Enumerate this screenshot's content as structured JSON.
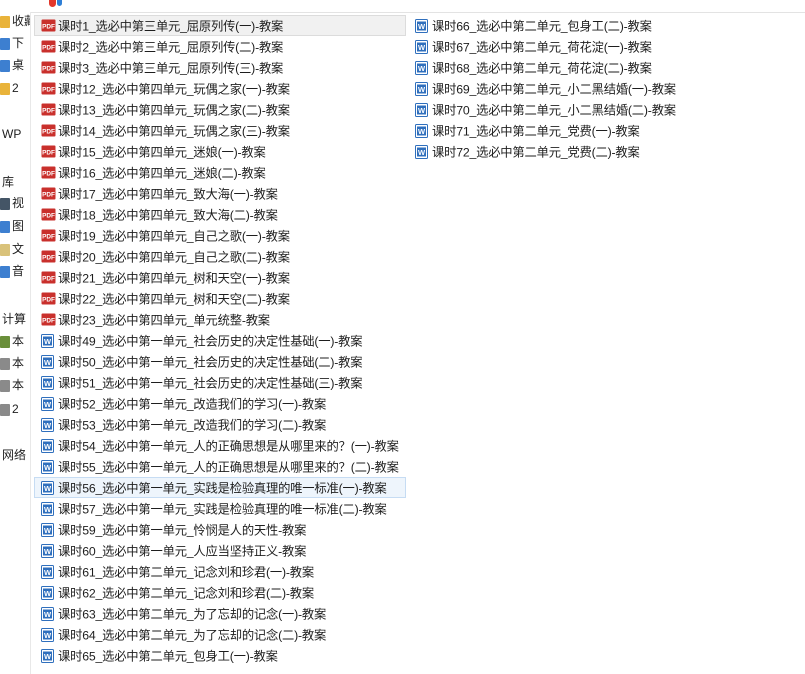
{
  "nav": {
    "items": [
      {
        "label": "收藏",
        "icon": "star-folder-icon",
        "color": "#e9b33a"
      },
      {
        "label": "下",
        "icon": "download-folder-icon",
        "color": "#3d7fd0"
      },
      {
        "label": "桌",
        "icon": "desktop-folder-icon",
        "color": "#3d7fd0"
      },
      {
        "label": "2",
        "icon": "folder-icon",
        "color": "#e9b33a"
      },
      {
        "label": "WP",
        "icon": "",
        "color": ""
      },
      {
        "label": "库",
        "icon": "",
        "color": ""
      },
      {
        "label": "视",
        "icon": "video-library-icon",
        "color": "#445566"
      },
      {
        "label": "图",
        "icon": "picture-library-icon",
        "color": "#3d7fd0"
      },
      {
        "label": "文",
        "icon": "document-library-icon",
        "color": "#d9c27a"
      },
      {
        "label": "音",
        "icon": "music-library-icon",
        "color": "#3d7fd0"
      },
      {
        "label": "计算",
        "icon": "",
        "color": ""
      },
      {
        "label": "本",
        "icon": "local-disk-icon",
        "color": "#6a8f3a"
      },
      {
        "label": "本",
        "icon": "drive-icon",
        "color": "#8a8a8a"
      },
      {
        "label": "本",
        "icon": "drive-icon",
        "color": "#8a8a8a"
      },
      {
        "label": "2",
        "icon": "drive-icon",
        "color": "#8a8a8a"
      },
      {
        "label": "网络",
        "icon": "",
        "color": ""
      }
    ]
  },
  "files": {
    "column1": [
      {
        "name": "课时1_选必中第三单元_屈原列传(一)-教案",
        "type": "pdf"
      },
      {
        "name": "课时2_选必中第三单元_屈原列传(二)-教案",
        "type": "pdf"
      },
      {
        "name": "课时3_选必中第三单元_屈原列传(三)-教案",
        "type": "pdf"
      },
      {
        "name": "课时12_选必中第四单元_玩偶之家(一)-教案",
        "type": "pdf"
      },
      {
        "name": "课时13_选必中第四单元_玩偶之家(二)-教案",
        "type": "pdf"
      },
      {
        "name": "课时14_选必中第四单元_玩偶之家(三)-教案",
        "type": "pdf"
      },
      {
        "name": "课时15_选必中第四单元_迷娘(一)-教案",
        "type": "pdf"
      },
      {
        "name": "课时16_选必中第四单元_迷娘(二)-教案",
        "type": "pdf"
      },
      {
        "name": "课时17_选必中第四单元_致大海(一)-教案",
        "type": "pdf"
      },
      {
        "name": "课时18_选必中第四单元_致大海(二)-教案",
        "type": "pdf"
      },
      {
        "name": "课时19_选必中第四单元_自己之歌(一)-教案",
        "type": "pdf"
      },
      {
        "name": "课时20_选必中第四单元_自己之歌(二)-教案",
        "type": "pdf"
      },
      {
        "name": "课时21_选必中第四单元_树和天空(一)-教案",
        "type": "pdf"
      },
      {
        "name": "课时22_选必中第四单元_树和天空(二)-教案",
        "type": "pdf"
      },
      {
        "name": "课时23_选必中第四单元_单元统整-教案",
        "type": "pdf"
      },
      {
        "name": "课时49_选必中第一单元_社会历史的决定性基础(一)-教案",
        "type": "doc"
      },
      {
        "name": "课时50_选必中第一单元_社会历史的决定性基础(二)-教案",
        "type": "doc"
      },
      {
        "name": "课时51_选必中第一单元_社会历史的决定性基础(三)-教案",
        "type": "doc"
      },
      {
        "name": "课时52_选必中第一单元_改造我们的学习(一)-教案",
        "type": "doc"
      },
      {
        "name": "课时53_选必中第一单元_改造我们的学习(二)-教案",
        "type": "doc"
      },
      {
        "name": "课时54_选必中第一单元_人的正确思想是从哪里来的？(一)-教案",
        "type": "doc"
      },
      {
        "name": "课时55_选必中第一单元_人的正确思想是从哪里来的？(二)-教案",
        "type": "doc"
      },
      {
        "name": "课时56_选必中第一单元_实践是检验真理的唯一标准(一)-教案",
        "type": "doc"
      },
      {
        "name": "课时57_选必中第一单元_实践是检验真理的唯一标准(二)-教案",
        "type": "doc"
      },
      {
        "name": "课时59_选必中第一单元_怜悯是人的天性-教案",
        "type": "doc"
      },
      {
        "name": "课时60_选必中第一单元_人应当坚持正义-教案",
        "type": "doc"
      },
      {
        "name": "课时61_选必中第二单元_记念刘和珍君(一)-教案",
        "type": "doc"
      },
      {
        "name": "课时62_选必中第二单元_记念刘和珍君(二)-教案",
        "type": "doc"
      },
      {
        "name": "课时63_选必中第二单元_为了忘却的记念(一)-教案",
        "type": "doc"
      },
      {
        "name": "课时64_选必中第二单元_为了忘却的记念(二)-教案",
        "type": "doc"
      },
      {
        "name": "课时65_选必中第二单元_包身工(一)-教案",
        "type": "doc"
      }
    ],
    "column2": [
      {
        "name": "课时66_选必中第二单元_包身工(二)-教案",
        "type": "doc"
      },
      {
        "name": "课时67_选必中第二单元_荷花淀(一)-教案",
        "type": "doc"
      },
      {
        "name": "课时68_选必中第二单元_荷花淀(二)-教案",
        "type": "doc"
      },
      {
        "name": "课时69_选必中第二单元_小二黑结婚(一)-教案",
        "type": "doc"
      },
      {
        "name": "课时70_选必中第二单元_小二黑结婚(二)-教案",
        "type": "doc"
      },
      {
        "name": "课时71_选必中第二单元_党费(一)-教案",
        "type": "doc"
      },
      {
        "name": "课时72_选必中第二单元_党费(二)-教案",
        "type": "doc"
      }
    ],
    "pdf_badge": "PDF",
    "doc_badge": "W"
  },
  "colors": {
    "pdf_red": "#c9302c",
    "doc_blue": "#2f6fbd",
    "selection_gray": "#f1f1f1",
    "selection_blue": "#eef5fc"
  }
}
